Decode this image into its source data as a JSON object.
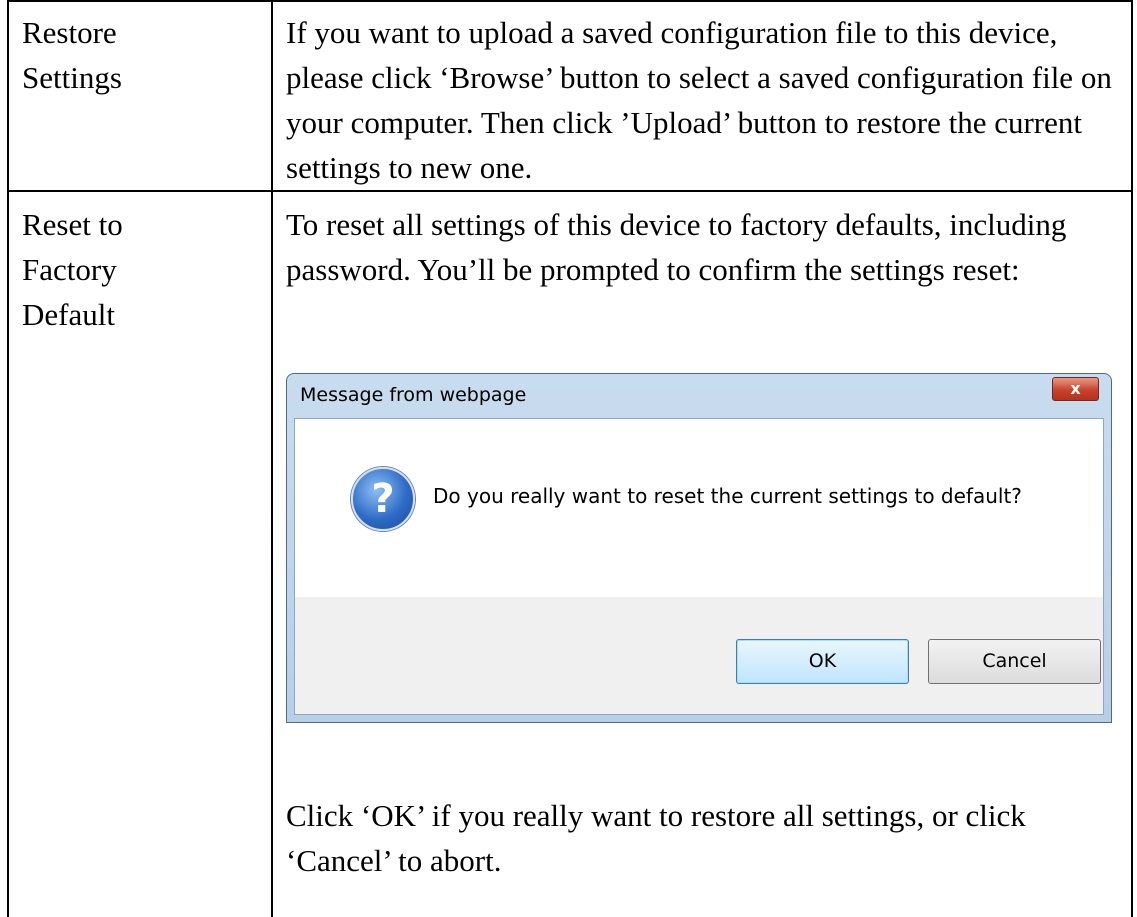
{
  "rows": [
    {
      "label_lines": [
        "Restore",
        "Settings"
      ],
      "description": "If you want to upload a saved configuration file to this device, please click ‘Browse’ button to select a saved configuration file on your computer. Then click ’Upload’ button to restore the current settings to new one."
    },
    {
      "label_lines": [
        "Reset to",
        "Factory",
        "Default"
      ],
      "description": "To reset all settings of this device to factory defaults, including password. You’ll be prompted to confirm the settings reset:",
      "after_dialog": "Click ‘OK’ if you really want to restore all settings, or click ‘Cancel’ to abort."
    }
  ],
  "dialog": {
    "title": "Message from webpage",
    "close_glyph": "x",
    "icon": "question-icon",
    "icon_glyph": "?",
    "message": "Do you really want to reset the current settings to default?",
    "ok_label": "OK",
    "cancel_label": "Cancel"
  }
}
